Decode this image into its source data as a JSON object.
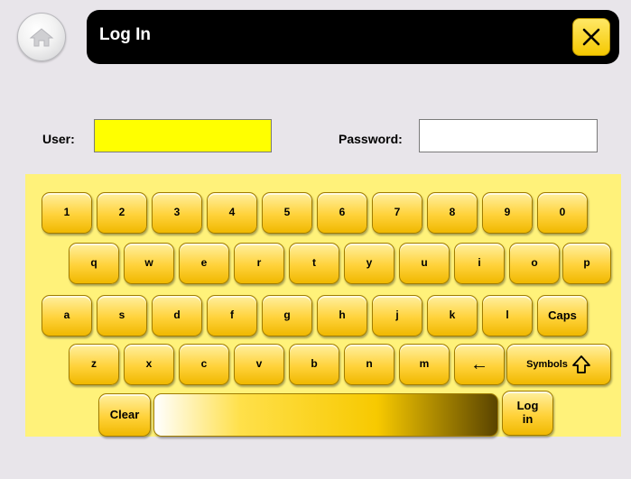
{
  "header": {
    "title": "Log In"
  },
  "form": {
    "user_label": "User:",
    "user_value": "",
    "password_label": "Password:",
    "password_value": ""
  },
  "keyboard": {
    "row1": [
      "1",
      "2",
      "3",
      "4",
      "5",
      "6",
      "7",
      "8",
      "9",
      "0"
    ],
    "row2": [
      "q",
      "w",
      "e",
      "r",
      "t",
      "y",
      "u",
      "i",
      "o",
      "p"
    ],
    "row3": [
      "a",
      "s",
      "d",
      "f",
      "g",
      "h",
      "j",
      "k",
      "l"
    ],
    "caps": "Caps",
    "row4": [
      "z",
      "x",
      "c",
      "v",
      "b",
      "n",
      "m"
    ],
    "backspace": "←",
    "symbols": "Symbols",
    "clear": "Clear",
    "login_line1": "Log",
    "login_line2": "in"
  },
  "colors": {
    "accent": "#ffd23a",
    "user_field_active": "#ffff00",
    "header_bg": "#000000"
  },
  "icons": {
    "home": "home-icon",
    "close": "close-icon",
    "shift": "shift-up-arrow-icon"
  }
}
